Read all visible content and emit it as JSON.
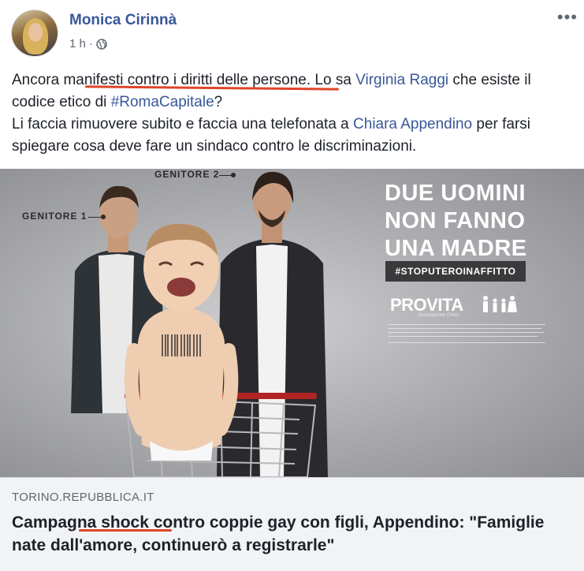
{
  "post": {
    "author": "Monica Cirinnà",
    "time": "1 h",
    "separator": "·",
    "more": "•••"
  },
  "text": {
    "p1_part1": "Ancora manifesti contro i diritti delle persone. Lo sa ",
    "mention_raggi": "Virginia Raggi",
    "p1_part2": " che esiste il codice etico di ",
    "hashtag": "#RomaCapitale",
    "p1_part3": "?",
    "p2_part1": "Li faccia rimuovere subito e faccia una telefonata a ",
    "mention_appendino": "Chiara Appendino",
    "p2_part2": " per farsi spiegare cosa deve fare un sindaco contro le discriminazioni."
  },
  "ad": {
    "label_genitore_1": "GENITORE 1",
    "label_genitore_2": "GENITORE 2",
    "title_line1": "DUE UOMINI",
    "title_line2": "NON FANNO",
    "title_line3": "UNA MADRE",
    "hashtag": "#STOPUTEROINAFFITTO",
    "logo": "PROVITA",
    "logo_sub": "Associazione Onlus"
  },
  "preview": {
    "source": "TORINO.REPUBBLICA.IT",
    "headline": "Campagna shock contro coppie gay con figli, Appendino: \"Famiglie nate dall'amore, continuerò a registrarle\""
  },
  "colors": {
    "link": "#385898",
    "annotation_red": "#e0452a",
    "preview_bg": "#f2f3f5"
  }
}
